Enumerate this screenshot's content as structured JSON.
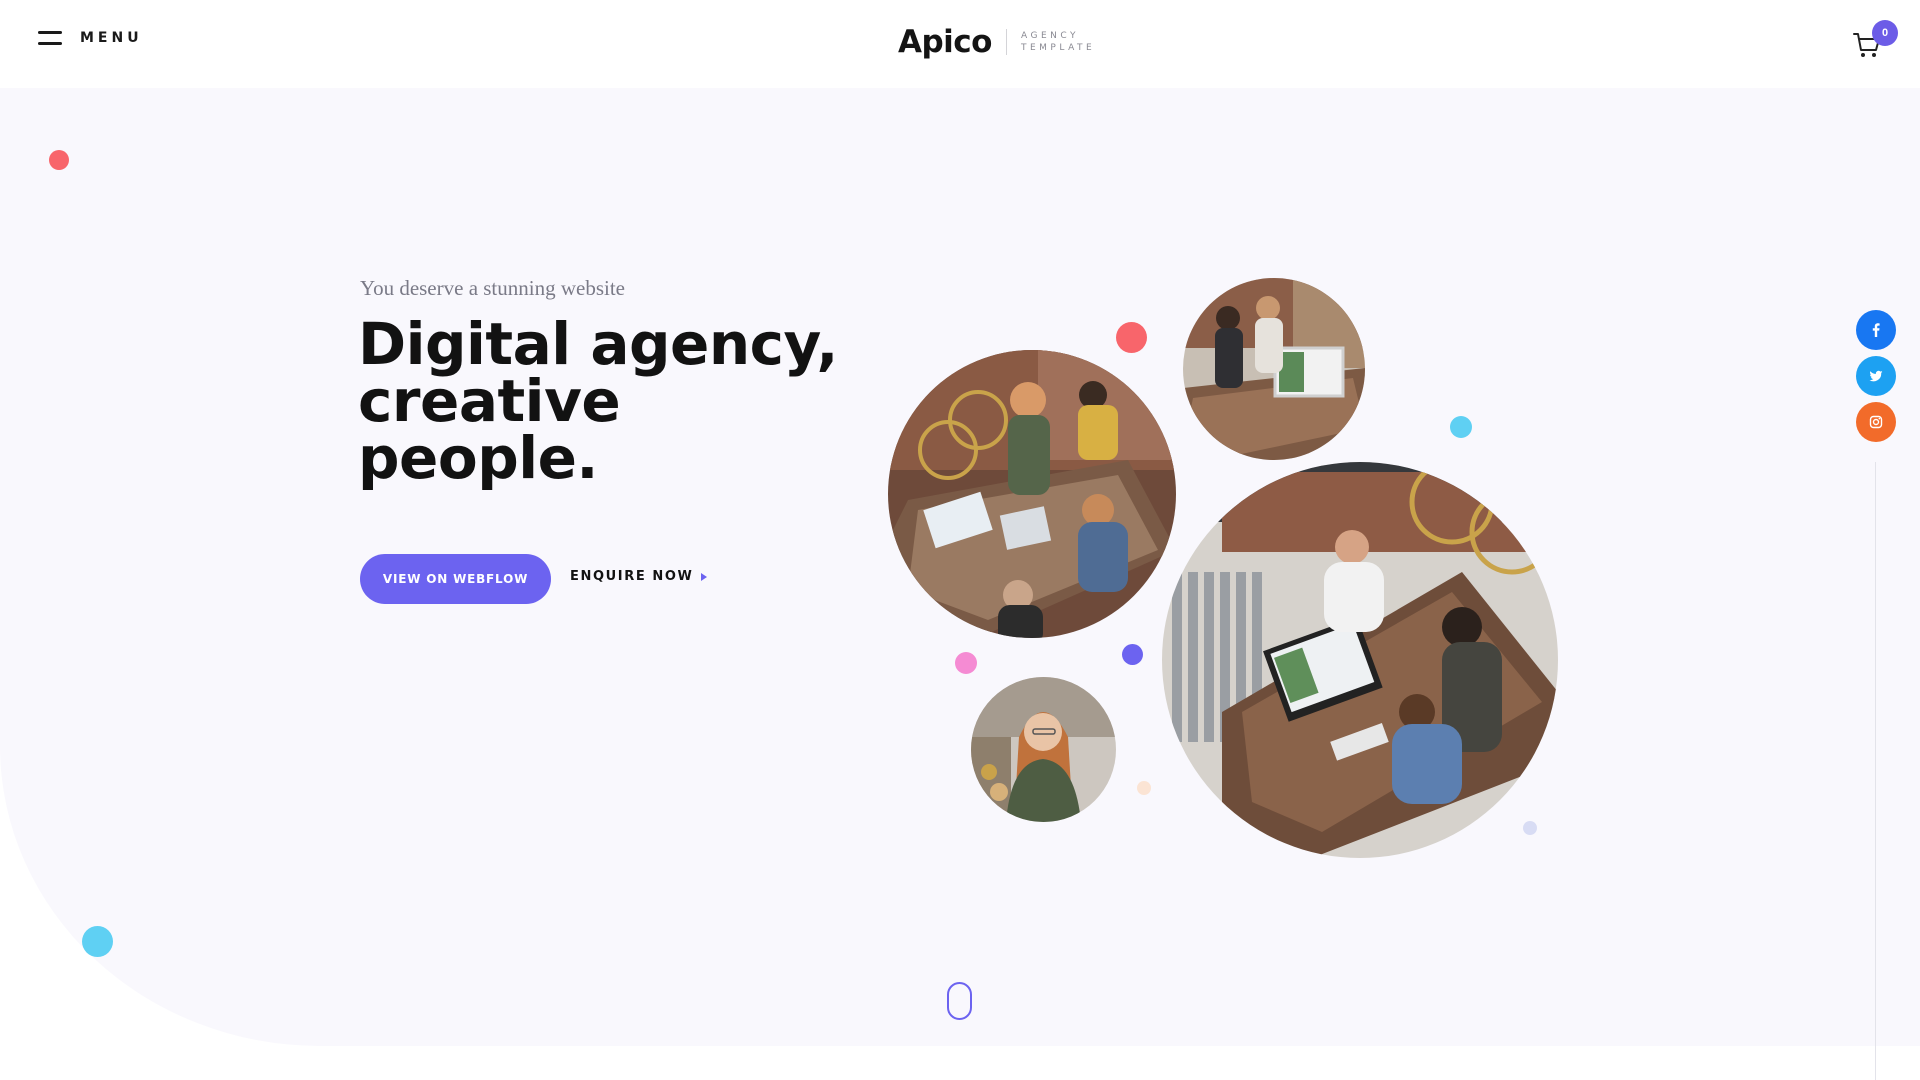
{
  "header": {
    "menu_label": "MENU",
    "logo_word": "Apico",
    "logo_tag_line1": "AGENCY",
    "logo_tag_line2": "TEMPLATE",
    "cart_count": "0"
  },
  "hero": {
    "subtitle": "You deserve a stunning website",
    "title_line1": "Digital agency,",
    "title_line2": "creative",
    "title_line3": "people.",
    "primary_button": "VIEW ON WEBFLOW",
    "secondary_link": "ENQUIRE NOW"
  },
  "social": {
    "facebook_color": "#1877f2",
    "twitter_color": "#1da1f2",
    "instagram_color": "#f26b2a"
  },
  "colors": {
    "accent": "#6c63f0",
    "coral": "#f8656b",
    "sky": "#5fd0f3",
    "pink": "#f58bd3",
    "hero_background": "#f9f8fd"
  }
}
